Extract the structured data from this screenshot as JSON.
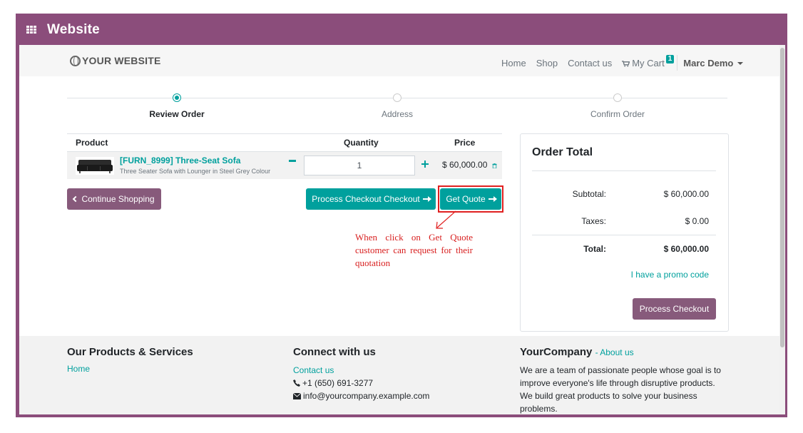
{
  "appbar": {
    "app_name": "Website",
    "menu_icon": "grid-icon"
  },
  "navbar": {
    "logo_text": "YOUR WEBSITE",
    "logo_icon": "globe-icon",
    "links": [
      "Home",
      "Shop",
      "Contact us"
    ],
    "cart_label": "My Cart",
    "cart_count": "1",
    "user_name": "Marc Demo"
  },
  "wizard": {
    "steps": [
      {
        "label": "Review Order",
        "active": true
      },
      {
        "label": "Address",
        "active": false
      },
      {
        "label": "Confirm Order",
        "active": false
      }
    ]
  },
  "cart": {
    "headers": {
      "product": "Product",
      "quantity": "Quantity",
      "price": "Price"
    },
    "rows": [
      {
        "name": "[FURN_8999] Three-Seat Sofa",
        "description": "Three Seater Sofa with Lounger in Steel Grey Colour",
        "quantity": "1",
        "price": "$ 60,000.00"
      }
    ]
  },
  "buttons": {
    "continue_shopping": "Continue Shopping",
    "process_checkout_left": "Process Checkout Checkout",
    "get_quote": "Get Quote",
    "process_checkout_right": "Process Checkout"
  },
  "annotation": {
    "text": "When click on Get Quote customer can request for their quotation",
    "color": "#d81f1f"
  },
  "summary": {
    "title": "Order Total",
    "subtotal_label": "Subtotal:",
    "subtotal_value": "$ 60,000.00",
    "taxes_label": "Taxes:",
    "taxes_value": "$ 0.00",
    "total_label": "Total:",
    "total_value": "$ 60,000.00",
    "promo_link": "I have a promo code"
  },
  "footer": {
    "col1": {
      "title": "Our Products & Services",
      "link": "Home"
    },
    "col2": {
      "title": "Connect with us",
      "link": "Contact us",
      "phone": "+1 (650) 691-3277",
      "email": "info@yourcompany.example.com"
    },
    "col3": {
      "title": "YourCompany",
      "about_link": "- About us",
      "text": "We are a team of passionate people whose goal is to improve everyone's life through disruptive products. We build great products to solve your business problems."
    }
  },
  "colors": {
    "brand_purple": "#875a7b",
    "frame_purple": "#8b4d7b",
    "teal": "#00a09d"
  }
}
